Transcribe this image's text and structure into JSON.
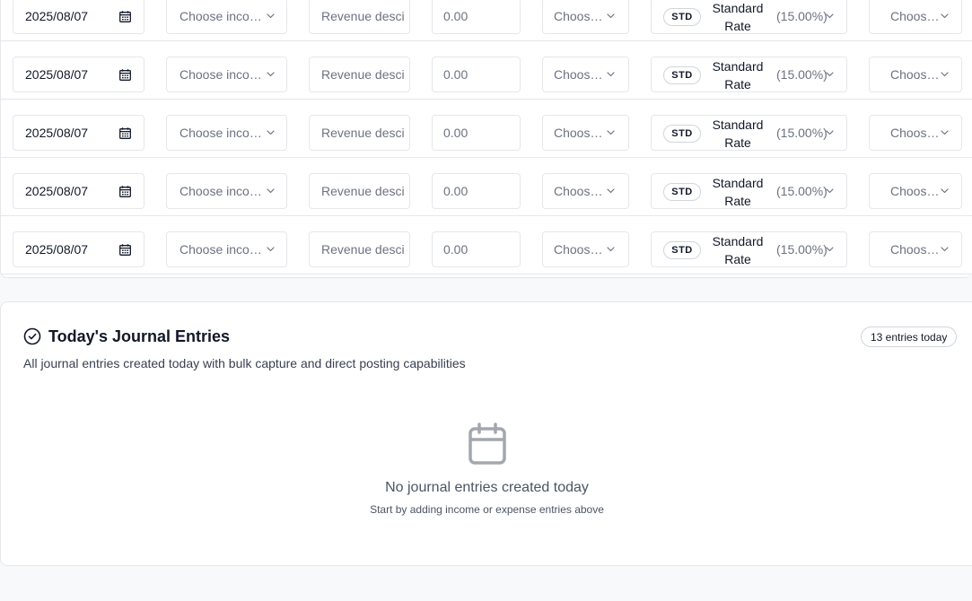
{
  "entries": {
    "rows": [
      {
        "date": "2025/08/07",
        "income_placeholder": "Choose incom...",
        "description_placeholder": "Revenue desci",
        "amount_placeholder": "0.00",
        "account_placeholder": "Choose...",
        "vat_badge": "STD",
        "vat_name": "Standard Rate",
        "vat_rate": "(15.00%)",
        "last_placeholder": "Choose..."
      },
      {
        "date": "2025/08/07",
        "income_placeholder": "Choose incom...",
        "description_placeholder": "Revenue desci",
        "amount_placeholder": "0.00",
        "account_placeholder": "Choose...",
        "vat_badge": "STD",
        "vat_name": "Standard Rate",
        "vat_rate": "(15.00%)",
        "last_placeholder": "Choose..."
      },
      {
        "date": "2025/08/07",
        "income_placeholder": "Choose incom...",
        "description_placeholder": "Revenue desci",
        "amount_placeholder": "0.00",
        "account_placeholder": "Choose...",
        "vat_badge": "STD",
        "vat_name": "Standard Rate",
        "vat_rate": "(15.00%)",
        "last_placeholder": "Choose..."
      },
      {
        "date": "2025/08/07",
        "income_placeholder": "Choose incom...",
        "description_placeholder": "Revenue desci",
        "amount_placeholder": "0.00",
        "account_placeholder": "Choose...",
        "vat_badge": "STD",
        "vat_name": "Standard Rate",
        "vat_rate": "(15.00%)",
        "last_placeholder": "Choose..."
      },
      {
        "date": "2025/08/07",
        "income_placeholder": "Choose incom...",
        "description_placeholder": "Revenue desci",
        "amount_placeholder": "0.00",
        "account_placeholder": "Choose...",
        "vat_badge": "STD",
        "vat_name": "Standard Rate",
        "vat_rate": "(15.00%)",
        "last_placeholder": "Choose..."
      }
    ],
    "icons": {
      "date": "calendar-icon",
      "dropdown": "chevron-down-icon"
    }
  },
  "journal": {
    "title": "Today's Journal Entries",
    "subtitle": "All journal entries created today with bulk capture and direct posting capabilities",
    "count_badge": "13 entries today",
    "title_icon": "check-circle-icon",
    "empty_icon": "calendar-icon",
    "empty_title": "No journal entries created today",
    "empty_hint": "Start by adding income or expense entries above"
  }
}
